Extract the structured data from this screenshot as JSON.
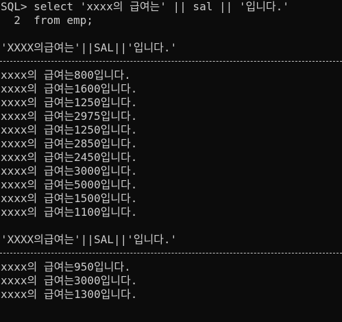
{
  "terminal": {
    "command_line_1": "SQL> select 'xxxx의 급여는' || sal || '입니다.'",
    "command_line_2": "  2  from emp;",
    "blocks": [
      {
        "header": "'XXXX의급여는'||SAL||'입니다.'",
        "rows": [
          "xxxx의 급여는800입니다.",
          "xxxx의 급여는1600입니다.",
          "xxxx의 급여는1250입니다.",
          "xxxx의 급여는2975입니다.",
          "xxxx의 급여는1250입니다.",
          "xxxx의 급여는2850입니다.",
          "xxxx의 급여는2450입니다.",
          "xxxx의 급여는3000입니다.",
          "xxxx의 급여는5000입니다.",
          "xxxx의 급여는1500입니다.",
          "xxxx의 급여는1100입니다."
        ]
      },
      {
        "header": "'XXXX의급여는'||SAL||'입니다.'",
        "rows": [
          "xxxx의 급여는950입니다.",
          "xxxx의 급여는3000입니다.",
          "xxxx의 급여는1300입니다."
        ]
      }
    ]
  },
  "colors": {
    "background": "#0c0c0c",
    "text": "#cccccc"
  }
}
